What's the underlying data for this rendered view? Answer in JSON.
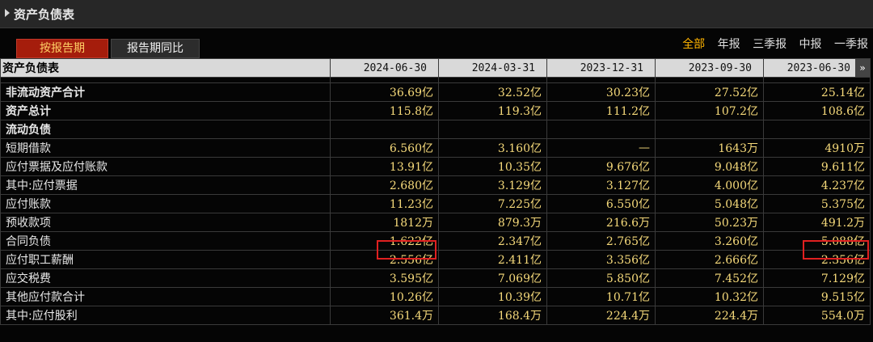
{
  "title": "资产负债表",
  "tabs": [
    {
      "label": "按报告期",
      "active": true
    },
    {
      "label": "报告期同比",
      "active": false
    }
  ],
  "filters": [
    {
      "label": "全部",
      "active": true
    },
    {
      "label": "年报",
      "active": false
    },
    {
      "label": "三季报",
      "active": false
    },
    {
      "label": "中报",
      "active": false
    },
    {
      "label": "一季报",
      "active": false
    }
  ],
  "table": {
    "header_label": "资产负债表",
    "columns": [
      "2024-06-30",
      "2024-03-31",
      "2023-12-31",
      "2023-09-30",
      "2023-06-30"
    ],
    "more_icon": "»",
    "rows": [
      {
        "label": "非流动资产合计",
        "level": 0,
        "values": [
          "36.69亿",
          "32.52亿",
          "30.23亿",
          "27.52亿",
          "25.14亿"
        ]
      },
      {
        "label": "资产总计",
        "level": 0,
        "values": [
          "115.8亿",
          "119.3亿",
          "111.2亿",
          "107.2亿",
          "108.6亿"
        ]
      },
      {
        "label": "流动负债",
        "level": 0,
        "values": [
          "",
          "",
          "",
          "",
          ""
        ]
      },
      {
        "label": "短期借款",
        "level": 1,
        "values": [
          "6.560亿",
          "3.160亿",
          "—",
          "1643万",
          "4910万"
        ]
      },
      {
        "label": "应付票据及应付账款",
        "level": 1,
        "values": [
          "13.91亿",
          "10.35亿",
          "9.676亿",
          "9.048亿",
          "9.611亿"
        ]
      },
      {
        "label": "其中:应付票据",
        "level": 1,
        "values": [
          "2.680亿",
          "3.129亿",
          "3.127亿",
          "4.000亿",
          "4.237亿"
        ]
      },
      {
        "label": "应付账款",
        "level": 2,
        "values": [
          "11.23亿",
          "7.225亿",
          "6.550亿",
          "5.048亿",
          "5.375亿"
        ]
      },
      {
        "label": "预收款项",
        "level": 1,
        "values": [
          "1812万",
          "879.3万",
          "216.6万",
          "50.23万",
          "491.2万"
        ]
      },
      {
        "label": "合同负债",
        "level": 1,
        "values": [
          "1.622亿",
          "2.347亿",
          "2.765亿",
          "3.260亿",
          "5.088亿"
        ]
      },
      {
        "label": "应付职工薪酬",
        "level": 1,
        "values": [
          "2.556亿",
          "2.411亿",
          "3.356亿",
          "2.666亿",
          "2.356亿"
        ]
      },
      {
        "label": "应交税费",
        "level": 1,
        "values": [
          "3.595亿",
          "7.069亿",
          "5.850亿",
          "7.452亿",
          "7.129亿"
        ]
      },
      {
        "label": "其他应付款合计",
        "level": 1,
        "values": [
          "10.26亿",
          "10.39亿",
          "10.71亿",
          "10.32亿",
          "9.515亿"
        ]
      },
      {
        "label": "其中:应付股利",
        "level": 1,
        "values": [
          "361.4万",
          "168.4万",
          "224.4万",
          "224.4万",
          "554.0万"
        ]
      }
    ]
  },
  "colors": {
    "value_text": "#f5d97a",
    "highlight": "#e02020",
    "active_tab": "#a51d0c",
    "active_filter": "#ffb400"
  }
}
